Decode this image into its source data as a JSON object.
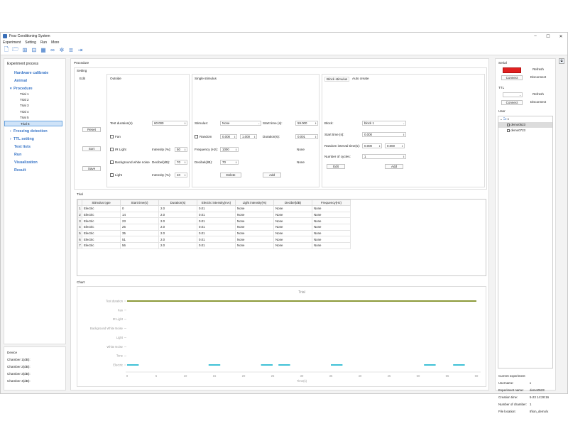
{
  "window": {
    "title": "Fear Conditioning System",
    "controls": [
      "–",
      "☐",
      "✕"
    ]
  },
  "menu": [
    "Experiment",
    "Setting",
    "Run",
    "More"
  ],
  "toolbar_icons": [
    "new-file-icon",
    "open-file-icon",
    "add-file-icon",
    "save-file-icon",
    "table-icon",
    "link-icon",
    "settings-group-icon",
    "stack-icon",
    "export-icon"
  ],
  "left": {
    "header": "Experiment process",
    "nav": [
      {
        "label": "Hardware calibrate",
        "arrow": ""
      },
      {
        "label": "Animal",
        "arrow": ""
      },
      {
        "label": "Procedure",
        "arrow": "▾"
      }
    ],
    "trials": [
      "Trial 1",
      "Trial 2",
      "Trial 3",
      "Trial 4",
      "Trial 5",
      "Trial 6"
    ],
    "selected_trial": 5,
    "nav2": [
      {
        "label": "Freezing detection",
        "arrow": "›"
      },
      {
        "label": "TTL setting",
        "arrow": "›"
      },
      {
        "label": "Test lists",
        "arrow": ""
      },
      {
        "label": "Run",
        "arrow": ""
      },
      {
        "label": "Visualization",
        "arrow": ""
      },
      {
        "label": "Result",
        "arrow": ""
      }
    ]
  },
  "devices": {
    "header": "Device",
    "rows": [
      "Chamber 1(dB):",
      "Chamber 2(dB):",
      "Chamber 3(dB):",
      "Chamber 4(dB):"
    ]
  },
  "procedure": {
    "title": "Procedure",
    "setting_title": "Setting",
    "edit": {
      "title": "Edit",
      "buttons": [
        "Reset",
        "Sort",
        "Save"
      ]
    },
    "outside": {
      "title": "Outside",
      "test_duration_label": "Test duration(s)",
      "test_duration_value": "60.000",
      "fan_label": "Fan",
      "ir_light_label": "IR Light",
      "ir_intensity_label": "Intensity (%):",
      "ir_intensity_value": "50",
      "bwn_label": "Background white noise",
      "db_label": "Decibel(dB):",
      "db_value": "70",
      "light_label": "Light",
      "light_intensity_label": "Intensity (%):",
      "light_intensity_value": "40"
    },
    "single": {
      "title": "Single stimulus",
      "stimulus_label": "Stimulus:",
      "stimulus_value": "None",
      "start_label": "Start time (s):",
      "start_value": "59.000",
      "random_label": "Random",
      "random_a": "0.000",
      "random_b": "1.000",
      "duration_label": "Duration(s):",
      "duration_value": "0.001",
      "freq_label": "Frequency (Hz):",
      "freq_value": "1000",
      "freq_right": "None",
      "db_label": "Decibel(dB):",
      "db_value": "70",
      "db_right": "None",
      "delete_label": "Delete",
      "add_label": "Add"
    },
    "block": {
      "tab1": "Block stimulus",
      "tab2": "Auto create",
      "block_label": "Block:",
      "block_value": "block 1",
      "start_label": "Start time (s):",
      "start_value": "0.000",
      "random_label": "Random interval time(s):",
      "random_a": "0.000",
      "random_b": "0.000",
      "cycles_label": "Number of cycles:",
      "cycles_value": "1",
      "edit_label": "Edit",
      "add_label": "Add"
    }
  },
  "trial_table": {
    "title": "Trial",
    "columns": [
      "Stimulus type",
      "Start time(s)",
      "Duration(s)",
      "Electric intensity(mA)",
      "Light intensity(%)",
      "Decibel(dB)",
      "Frequency(Hz)"
    ],
    "rows": [
      [
        "1",
        "Electric",
        "0",
        "2.0",
        "0.01",
        "None",
        "None",
        "None"
      ],
      [
        "2",
        "Electric",
        "14",
        "2.0",
        "0.01",
        "None",
        "None",
        "None"
      ],
      [
        "3",
        "Electric",
        "23",
        "2.0",
        "0.01",
        "None",
        "None",
        "None"
      ],
      [
        "4",
        "Electric",
        "26",
        "2.0",
        "0.01",
        "None",
        "None",
        "None"
      ],
      [
        "5",
        "Electric",
        "35",
        "2.0",
        "0.01",
        "None",
        "None",
        "None"
      ],
      [
        "6",
        "Electric",
        "51",
        "2.0",
        "0.01",
        "None",
        "None",
        "None"
      ],
      [
        "7",
        "Electric",
        "56",
        "2.0",
        "0.01",
        "None",
        "None",
        "None"
      ]
    ]
  },
  "chart_section": {
    "title": "Chart"
  },
  "chart_data": {
    "type": "timeline",
    "title": "Trial",
    "xlabel": "Time(s)",
    "xlim": [
      0,
      60
    ],
    "xticks": [
      0,
      5,
      10,
      15,
      20,
      25,
      30,
      35,
      40,
      45,
      50,
      55,
      60
    ],
    "categories": [
      "Test duration",
      "Fan",
      "IR Light",
      "Background White Noise",
      "Light",
      "White Noise",
      "Tone",
      "Electric"
    ],
    "series": [
      {
        "category": "Test duration",
        "color": "#8c9a3a",
        "segments": [
          [
            0,
            60
          ]
        ]
      },
      {
        "category": "Electric",
        "color": "#3fc1d6",
        "segments": [
          [
            0,
            2
          ],
          [
            14,
            16
          ],
          [
            23,
            25
          ],
          [
            26,
            28
          ],
          [
            35,
            37
          ],
          [
            51,
            53
          ],
          [
            56,
            58
          ]
        ]
      }
    ]
  },
  "right": {
    "serial_title": "Serial",
    "serial_refresh": "Refresh",
    "serial_connect": "Connect",
    "serial_disconnect": "Disconnect",
    "ttl_title": "TTL",
    "ttl_refresh": "Refresh",
    "ttl_connect": "Connect",
    "ttl_disconnect": "Disconnect",
    "user_title": "User",
    "user_root": "x",
    "users": [
      "demo0523",
      "demo0723"
    ],
    "selected_user": 0,
    "current_title": "Current experiment",
    "current": [
      {
        "k": "Username:",
        "v": "x"
      },
      {
        "k": "Experiment name:",
        "v": "demo0523"
      },
      {
        "k": "Creation time:",
        "v": "5-23 14:28:16"
      },
      {
        "k": "Number of chamber:",
        "v": "1"
      },
      {
        "k": "File location:",
        "v": "8\\lon_demo\\x"
      }
    ]
  },
  "colors": {
    "accent": "#3a76c7",
    "serial_status": "#e02020",
    "selection": "#cfe3f8"
  }
}
